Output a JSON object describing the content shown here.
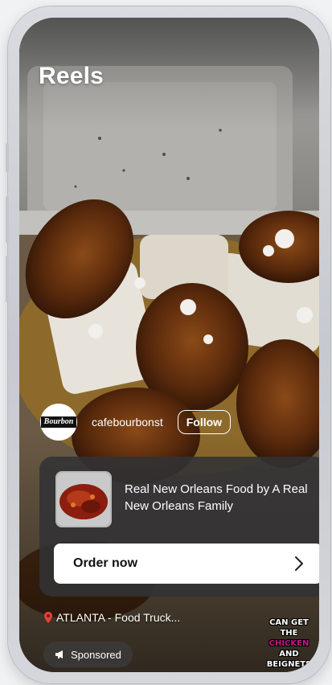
{
  "header": {
    "title": "Reels"
  },
  "account": {
    "username": "cafebourbonst",
    "follow_label": "Follow",
    "avatar_text": "Bourbon"
  },
  "ad": {
    "headline": "Real New Orleans Food by A Real New Orleans Family",
    "cta_label": "Order now",
    "cta_icon": "chevron-right-icon"
  },
  "location": {
    "text": "ATLANTA - Food Truck...",
    "icon": "map-pin-icon"
  },
  "sponsored": {
    "label": "Sponsored",
    "icon": "megaphone-icon"
  },
  "video_overlay": {
    "line1": "CAN GET",
    "line2_a": "THE",
    "line2_b": "CHICKEN",
    "line2_c": "AND",
    "line3": "BEIGNETS"
  },
  "colors": {
    "accent_pink": "#c7168a",
    "card_bg": "#323234",
    "cta_bg": "#ffffff"
  }
}
